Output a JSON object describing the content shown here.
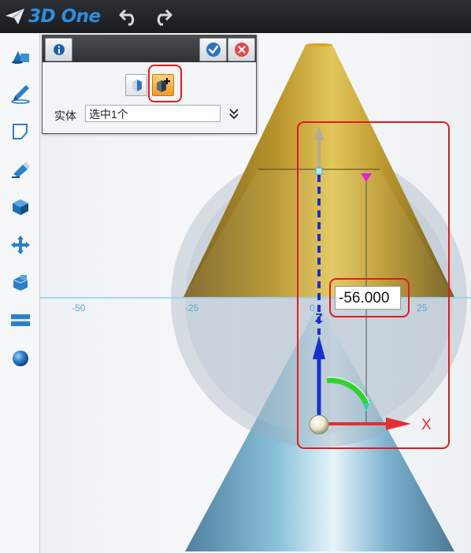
{
  "app": {
    "name": "3D One"
  },
  "toolbar": {
    "undo": "undo-icon",
    "redo": "redo-icon"
  },
  "sidebar": {
    "items": [
      {
        "icon": "basic-solids-icon"
      },
      {
        "icon": "sketch-draw-icon"
      },
      {
        "icon": "sketch-edit-icon"
      },
      {
        "icon": "feature-modify-icon"
      },
      {
        "icon": "special-feature-icon"
      },
      {
        "icon": "move-icon"
      },
      {
        "icon": "combine-icon"
      },
      {
        "icon": "measure-icon"
      },
      {
        "icon": "material-sphere-icon"
      }
    ]
  },
  "panel": {
    "field_label": "实体",
    "field_value": "选中1个"
  },
  "viewport": {
    "axis_ticks": [
      "-50",
      "-25",
      "0",
      "25"
    ],
    "dimension_value": "-56.000",
    "z_axis_label": "Z",
    "x_axis_label": "X"
  },
  "colors": {
    "cone_top": "#c9a83a",
    "cone_bottom": "#8cc3dc",
    "highlight": "#e01b1b",
    "axis_blue": "#1a2fd0",
    "axis_red": "#e03030",
    "arc_green": "#33d133"
  }
}
